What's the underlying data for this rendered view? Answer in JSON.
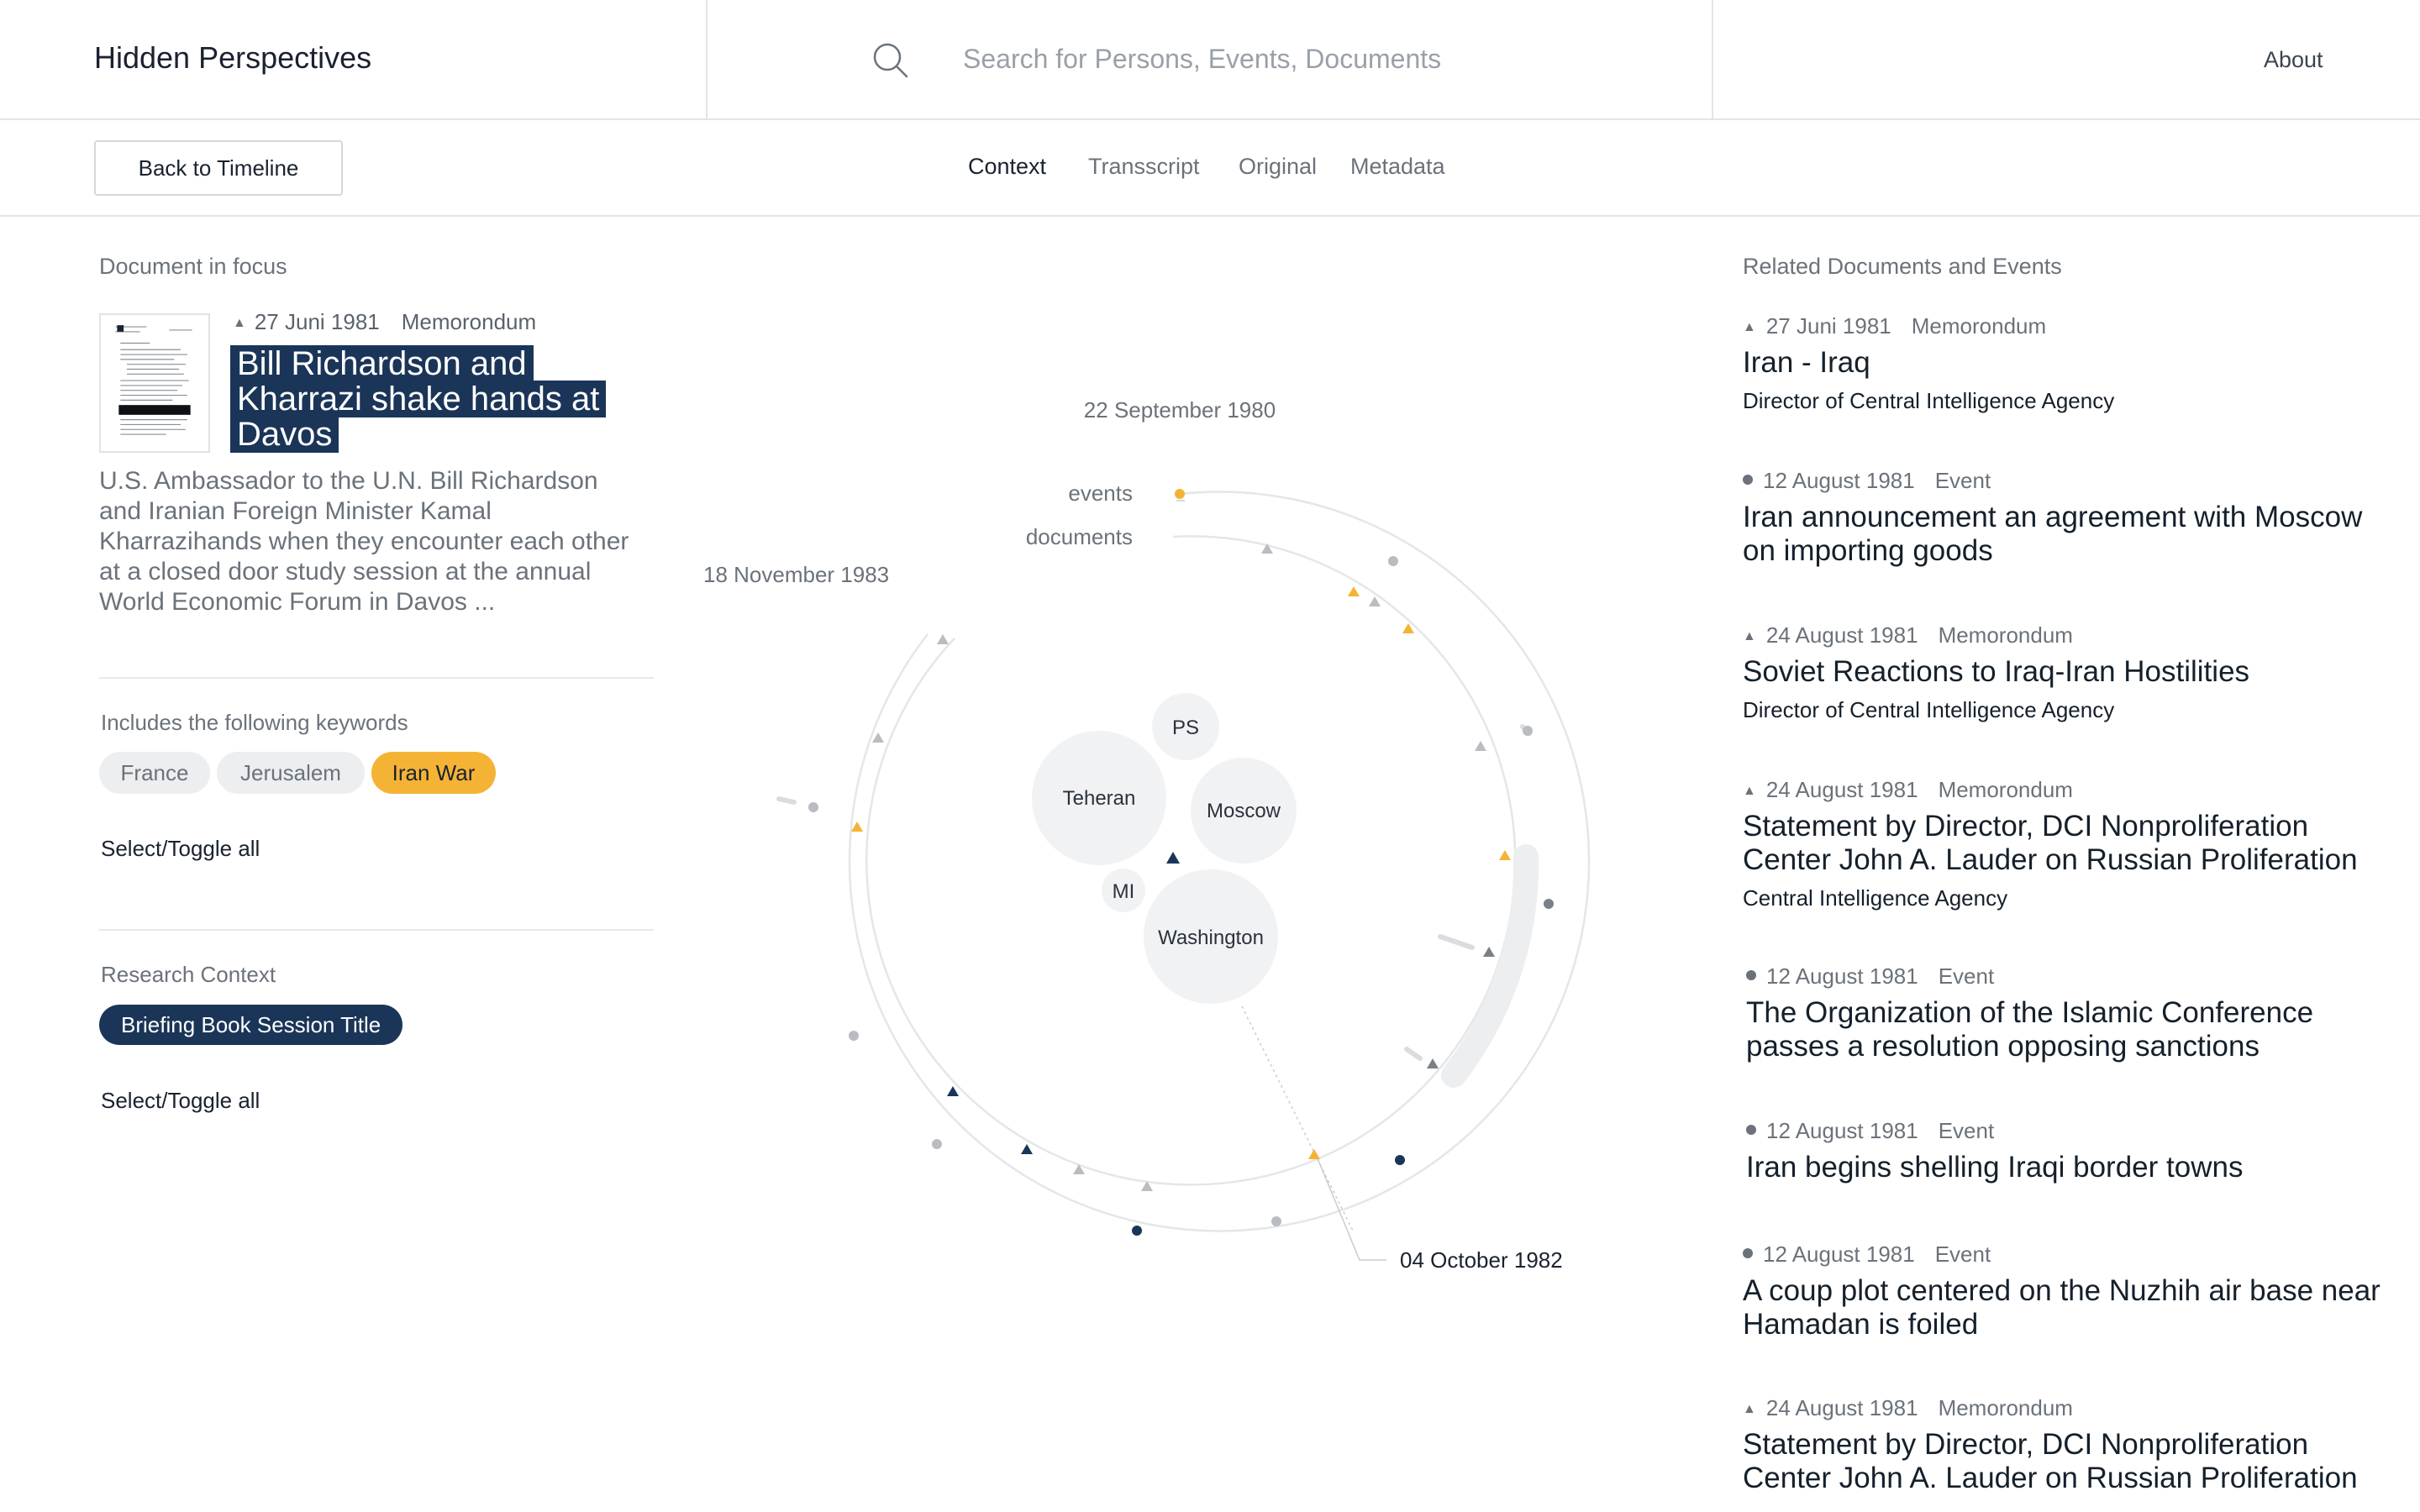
{
  "app": {
    "title": "Hidden Perspectives"
  },
  "search": {
    "placeholder": "Search for Persons, Events, Documents"
  },
  "nav": {
    "about": "About"
  },
  "toolbar": {
    "back_label": "Back to Timeline",
    "tabs": [
      {
        "label": "Context",
        "active": true
      },
      {
        "label": "Transscript",
        "active": false
      },
      {
        "label": "Original",
        "active": false
      },
      {
        "label": "Metadata",
        "active": false
      }
    ]
  },
  "focus": {
    "section_label": "Document in focus",
    "date": "27 Juni 1981",
    "type": "Memorondum",
    "title": "Bill Richardson and Kharrazi shake hands at Davos",
    "description": "U.S. Ambassador to the U.N. Bill Richardson and Iranian Foreign Minister Kamal Kharrazihands when they encounter each other at a closed door study session at the annual World Economic Forum in Davos ..."
  },
  "keywords": {
    "label": "Includes the following keywords",
    "items": [
      {
        "label": "France",
        "active": false
      },
      {
        "label": "Jerusalem",
        "active": false
      },
      {
        "label": "Iran War",
        "active": true
      }
    ],
    "toggle": "Select/Toggle all"
  },
  "research": {
    "label": "Research Context",
    "pill": "Briefing Book Session Title",
    "toggle": "Select/Toggle all"
  },
  "viz": {
    "date_top": "22 September 1980",
    "date_left": "18 November 1983",
    "date_bottom": "04 October 1982",
    "ring_events": "events",
    "ring_documents": "documents",
    "bubbles": [
      "PS",
      "Teheran",
      "Moscow",
      "MI",
      "Washington"
    ]
  },
  "related": {
    "label": "Related Documents and Events",
    "items": [
      {
        "marker": "triangle",
        "date": "27 Juni 1981",
        "kind": "Memorondum",
        "title": "Iran - Iraq",
        "source": "Director of Central Intelligence Agency"
      },
      {
        "marker": "dot",
        "date": "12 August 1981",
        "kind": "Event",
        "title": "Iran announcement an agreement with Moscow on importing goods",
        "source": ""
      },
      {
        "marker": "triangle",
        "date": "24 August 1981",
        "kind": "Memorondum",
        "title": "Soviet Reactions to Iraq-Iran Hostilities",
        "source": "Director of Central Intelligence Agency"
      },
      {
        "marker": "triangle",
        "date": "24 August 1981",
        "kind": "Memorondum",
        "title": "Statement by Director, DCI Nonproliferation Center John A. Lauder on Russian Proliferation",
        "source": "Central Intelligence Agency"
      },
      {
        "marker": "dot",
        "date": "12 August 1981",
        "kind": "Event",
        "title": "The Organization of the Islamic Conference passes a resolution opposing sanctions",
        "source": ""
      },
      {
        "marker": "dot",
        "date": "12 August 1981",
        "kind": "Event",
        "title": "Iran begins shelling Iraqi border towns",
        "source": ""
      },
      {
        "marker": "dot",
        "date": "12 August 1981",
        "kind": "Event",
        "title": "A coup plot centered on the Nuzhih air base near Hamadan is foiled",
        "source": ""
      },
      {
        "marker": "triangle",
        "date": "24 August 1981",
        "kind": "Memorondum",
        "title": "Statement by Director, DCI Nonproliferation Center John A. Lauder on Russian Proliferation",
        "source": ""
      }
    ]
  },
  "colors": {
    "navy": "#1b3558",
    "orange": "#f5b335",
    "grey": "#b9bdc2"
  }
}
